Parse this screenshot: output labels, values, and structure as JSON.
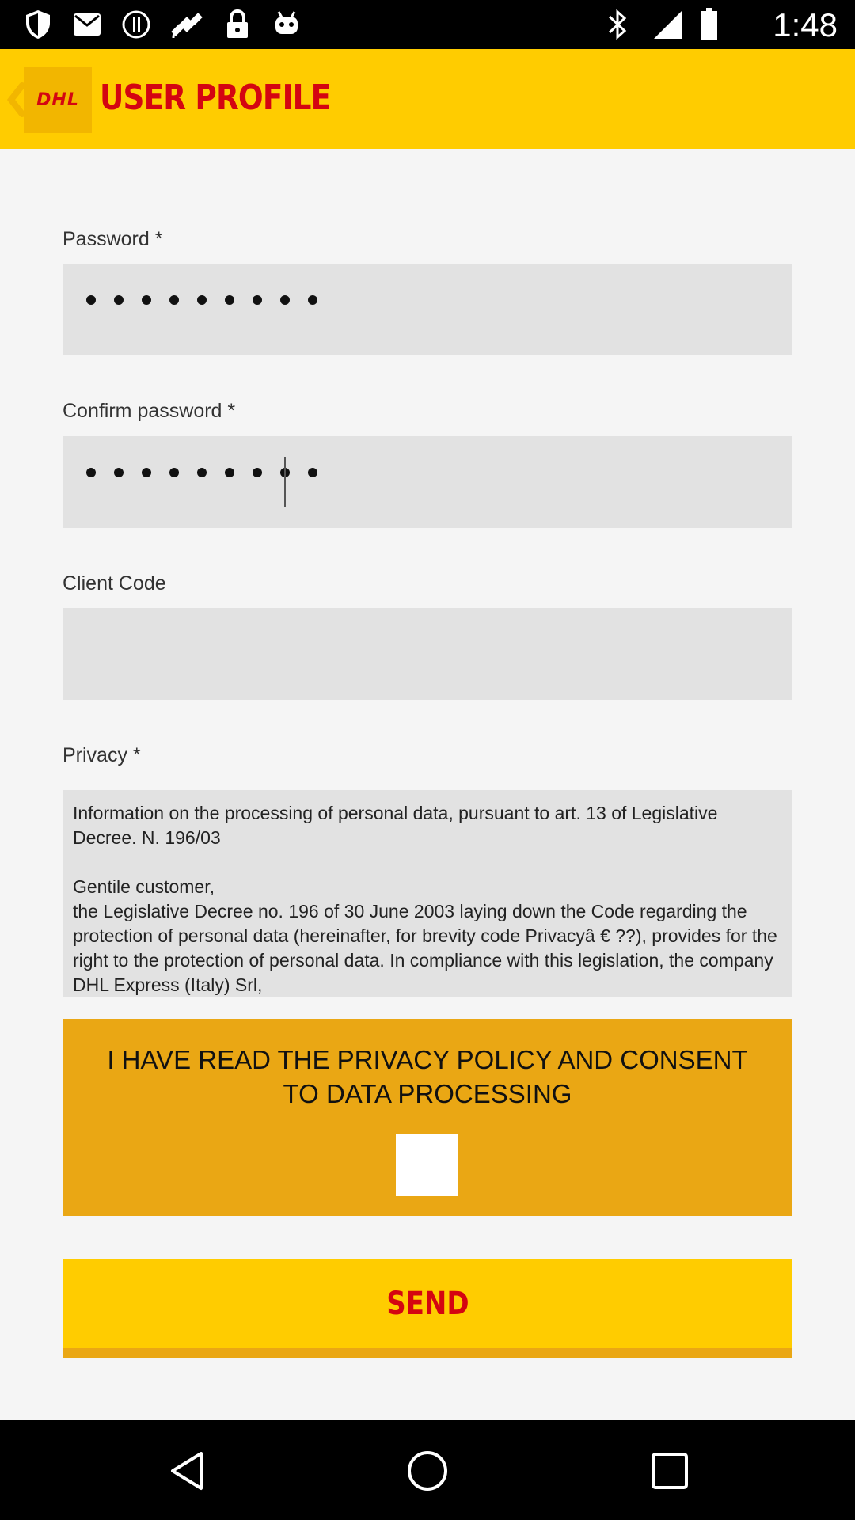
{
  "status_bar": {
    "time": "1:48",
    "icons": [
      "shield-icon",
      "mail-icon",
      "info-icon",
      "fake-gps-icon",
      "lock-icon",
      "android-icon",
      "bluetooth-icon",
      "signal-icon",
      "battery-icon"
    ]
  },
  "app_bar": {
    "logo_text": "DHL",
    "title": "USER PROFILE"
  },
  "form": {
    "password_label": "Password *",
    "password_length": 9,
    "confirm_label": "Confirm password *",
    "confirm_length": 9,
    "client_code_label": "Client Code",
    "client_code_value": "",
    "privacy_label": "Privacy *",
    "privacy_text": "Information on the processing of personal data, pursuant to art. 13 of Legislative Decree. N. 196/03\n\nGentile customer,\nthe Legislative Decree no. 196 of 30 June 2003 laying down the Code regarding the protection of personal data (hereinafter, for brevity code Privacyâ € ??), provides for the right to the protection of personal data. In compliance with this legislation, the company DHL Express (Italy) Srl,",
    "consent_text": "I HAVE READ THE PRIVACY POLICY AND CONSENT TO DATA PROCESSING",
    "consent_checked": false,
    "send_label": "SEND"
  },
  "colors": {
    "dhl_yellow": "#ffcc00",
    "dhl_red": "#d40511",
    "consent_orange": "#eaa714"
  }
}
